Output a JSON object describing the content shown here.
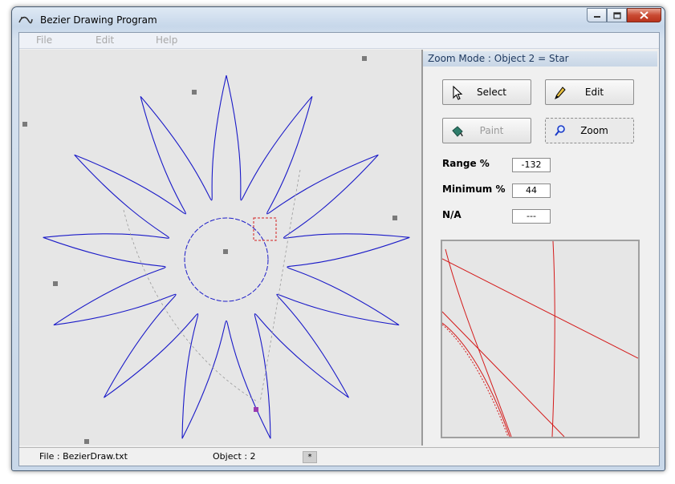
{
  "window": {
    "title": "Bezier Drawing Program"
  },
  "menu": {
    "items": [
      "File",
      "Edit",
      "Help"
    ]
  },
  "panel": {
    "mode_header": "Zoom Mode : Object 2 = Star",
    "buttons": {
      "select": "Select",
      "edit": "Edit",
      "paint": "Paint",
      "zoom": "Zoom"
    },
    "params": {
      "range_label": "Range %",
      "range_value": "-132",
      "minimum_label": "Minimum %",
      "minimum_value": "44",
      "na_label": "N/A",
      "na_value": "---"
    }
  },
  "status": {
    "file_label": "File  :  BezierDraw.txt",
    "object_label": "Object : 2",
    "mark": "*"
  },
  "colors": {
    "curve": "#1a1ac8",
    "preview_curve": "#d41a1a",
    "control_point": "#7a7a7a",
    "selected_point": "#9a3ab0",
    "selection_box": "#d42020"
  },
  "icons": {
    "select": "cursor-icon",
    "edit": "pencil-icon",
    "paint": "paint-bucket-icon",
    "zoom": "magnifier-icon"
  }
}
